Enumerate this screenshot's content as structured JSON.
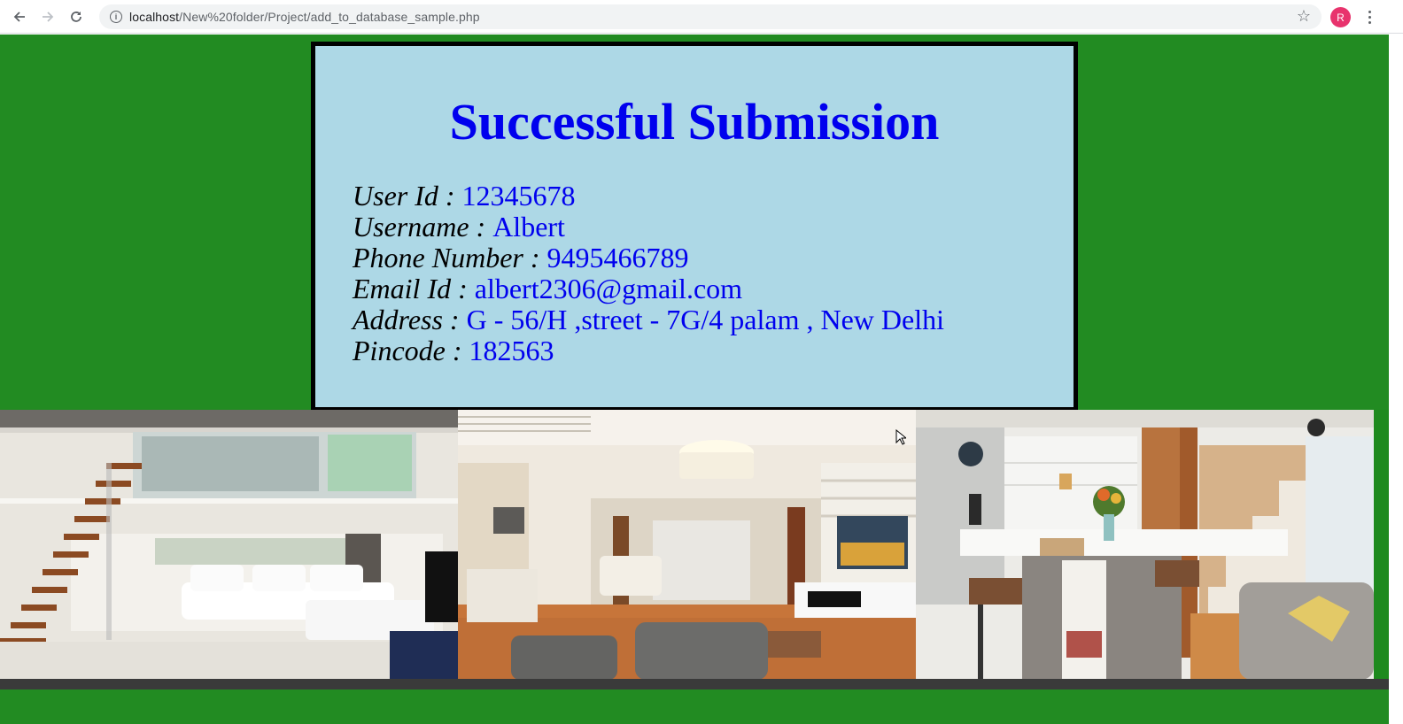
{
  "browser": {
    "url_host": "localhost",
    "url_path": "/New%20folder/Project/add_to_database_sample.php",
    "profile_initial": "R",
    "icons": {
      "back": "arrow-left-icon",
      "forward": "arrow-right-icon",
      "reload": "reload-icon",
      "info": "info-icon",
      "bookmark": "star-icon",
      "menu": "kebab-menu-icon"
    }
  },
  "card": {
    "title": "Successful Submission",
    "fields": [
      {
        "label": "User Id : ",
        "value": "12345678"
      },
      {
        "label": "Username : ",
        "value": "Albert"
      },
      {
        "label": "Phone Number : ",
        "value": "9495466789"
      },
      {
        "label": "Email Id : ",
        "value": "albert2306@gmail.com"
      },
      {
        "label": "Address : ",
        "value": "G - 56/H ,street - 7G/4 palam , New Delhi"
      },
      {
        "label": "Pincode : ",
        "value": "182563"
      }
    ]
  },
  "colors": {
    "page_background": "#228b22",
    "card_background": "#add8e6",
    "title_color": "#0000ee",
    "value_color": "#0000ee"
  },
  "gallery": [
    "interior-photo-staircase-lounge",
    "interior-photo-living-room",
    "interior-photo-kitchen"
  ]
}
